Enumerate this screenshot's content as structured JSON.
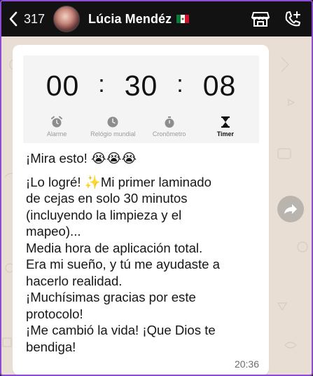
{
  "header": {
    "back_count": "317",
    "contact_name": "Lúcia Mendéz",
    "flag_icon": "mexico-flag-icon",
    "actions": [
      "store-icon",
      "add-call-icon"
    ]
  },
  "screenshot": {
    "timer": {
      "hours": "00",
      "minutes": "30",
      "seconds": "08",
      "separator": ":"
    },
    "tabs": [
      {
        "label": "Alarme",
        "icon": "alarm-icon"
      },
      {
        "label": "Relógio mundial",
        "icon": "clock-icon"
      },
      {
        "label": "Cronômetro",
        "icon": "stopwatch-icon"
      },
      {
        "label": "Timer",
        "icon": "hourglass-icon",
        "active": true
      }
    ]
  },
  "message": {
    "line1": "¡Mira esto! 😭😭😭",
    "body": [
      "¡Lo logré! ✨Mi primer laminado",
      "de cejas en solo 30 minutos",
      "(incluyendo la limpieza y el",
      "mapeo)...",
      "Media hora de aplicación total.",
      "Era mi sueño, y tú me ayudaste a",
      "hacerlo realidad.",
      "¡Muchísimas gracias por este",
      "protocolo!",
      "¡Me cambió la vida! ¡Que Dios te",
      "bendiga!"
    ],
    "time": "20:36"
  },
  "colors": {
    "header_bg": "#121212",
    "chat_bg": "#e9ded3",
    "bubble_bg": "#ffffff",
    "frame": "#8e4bd6"
  }
}
